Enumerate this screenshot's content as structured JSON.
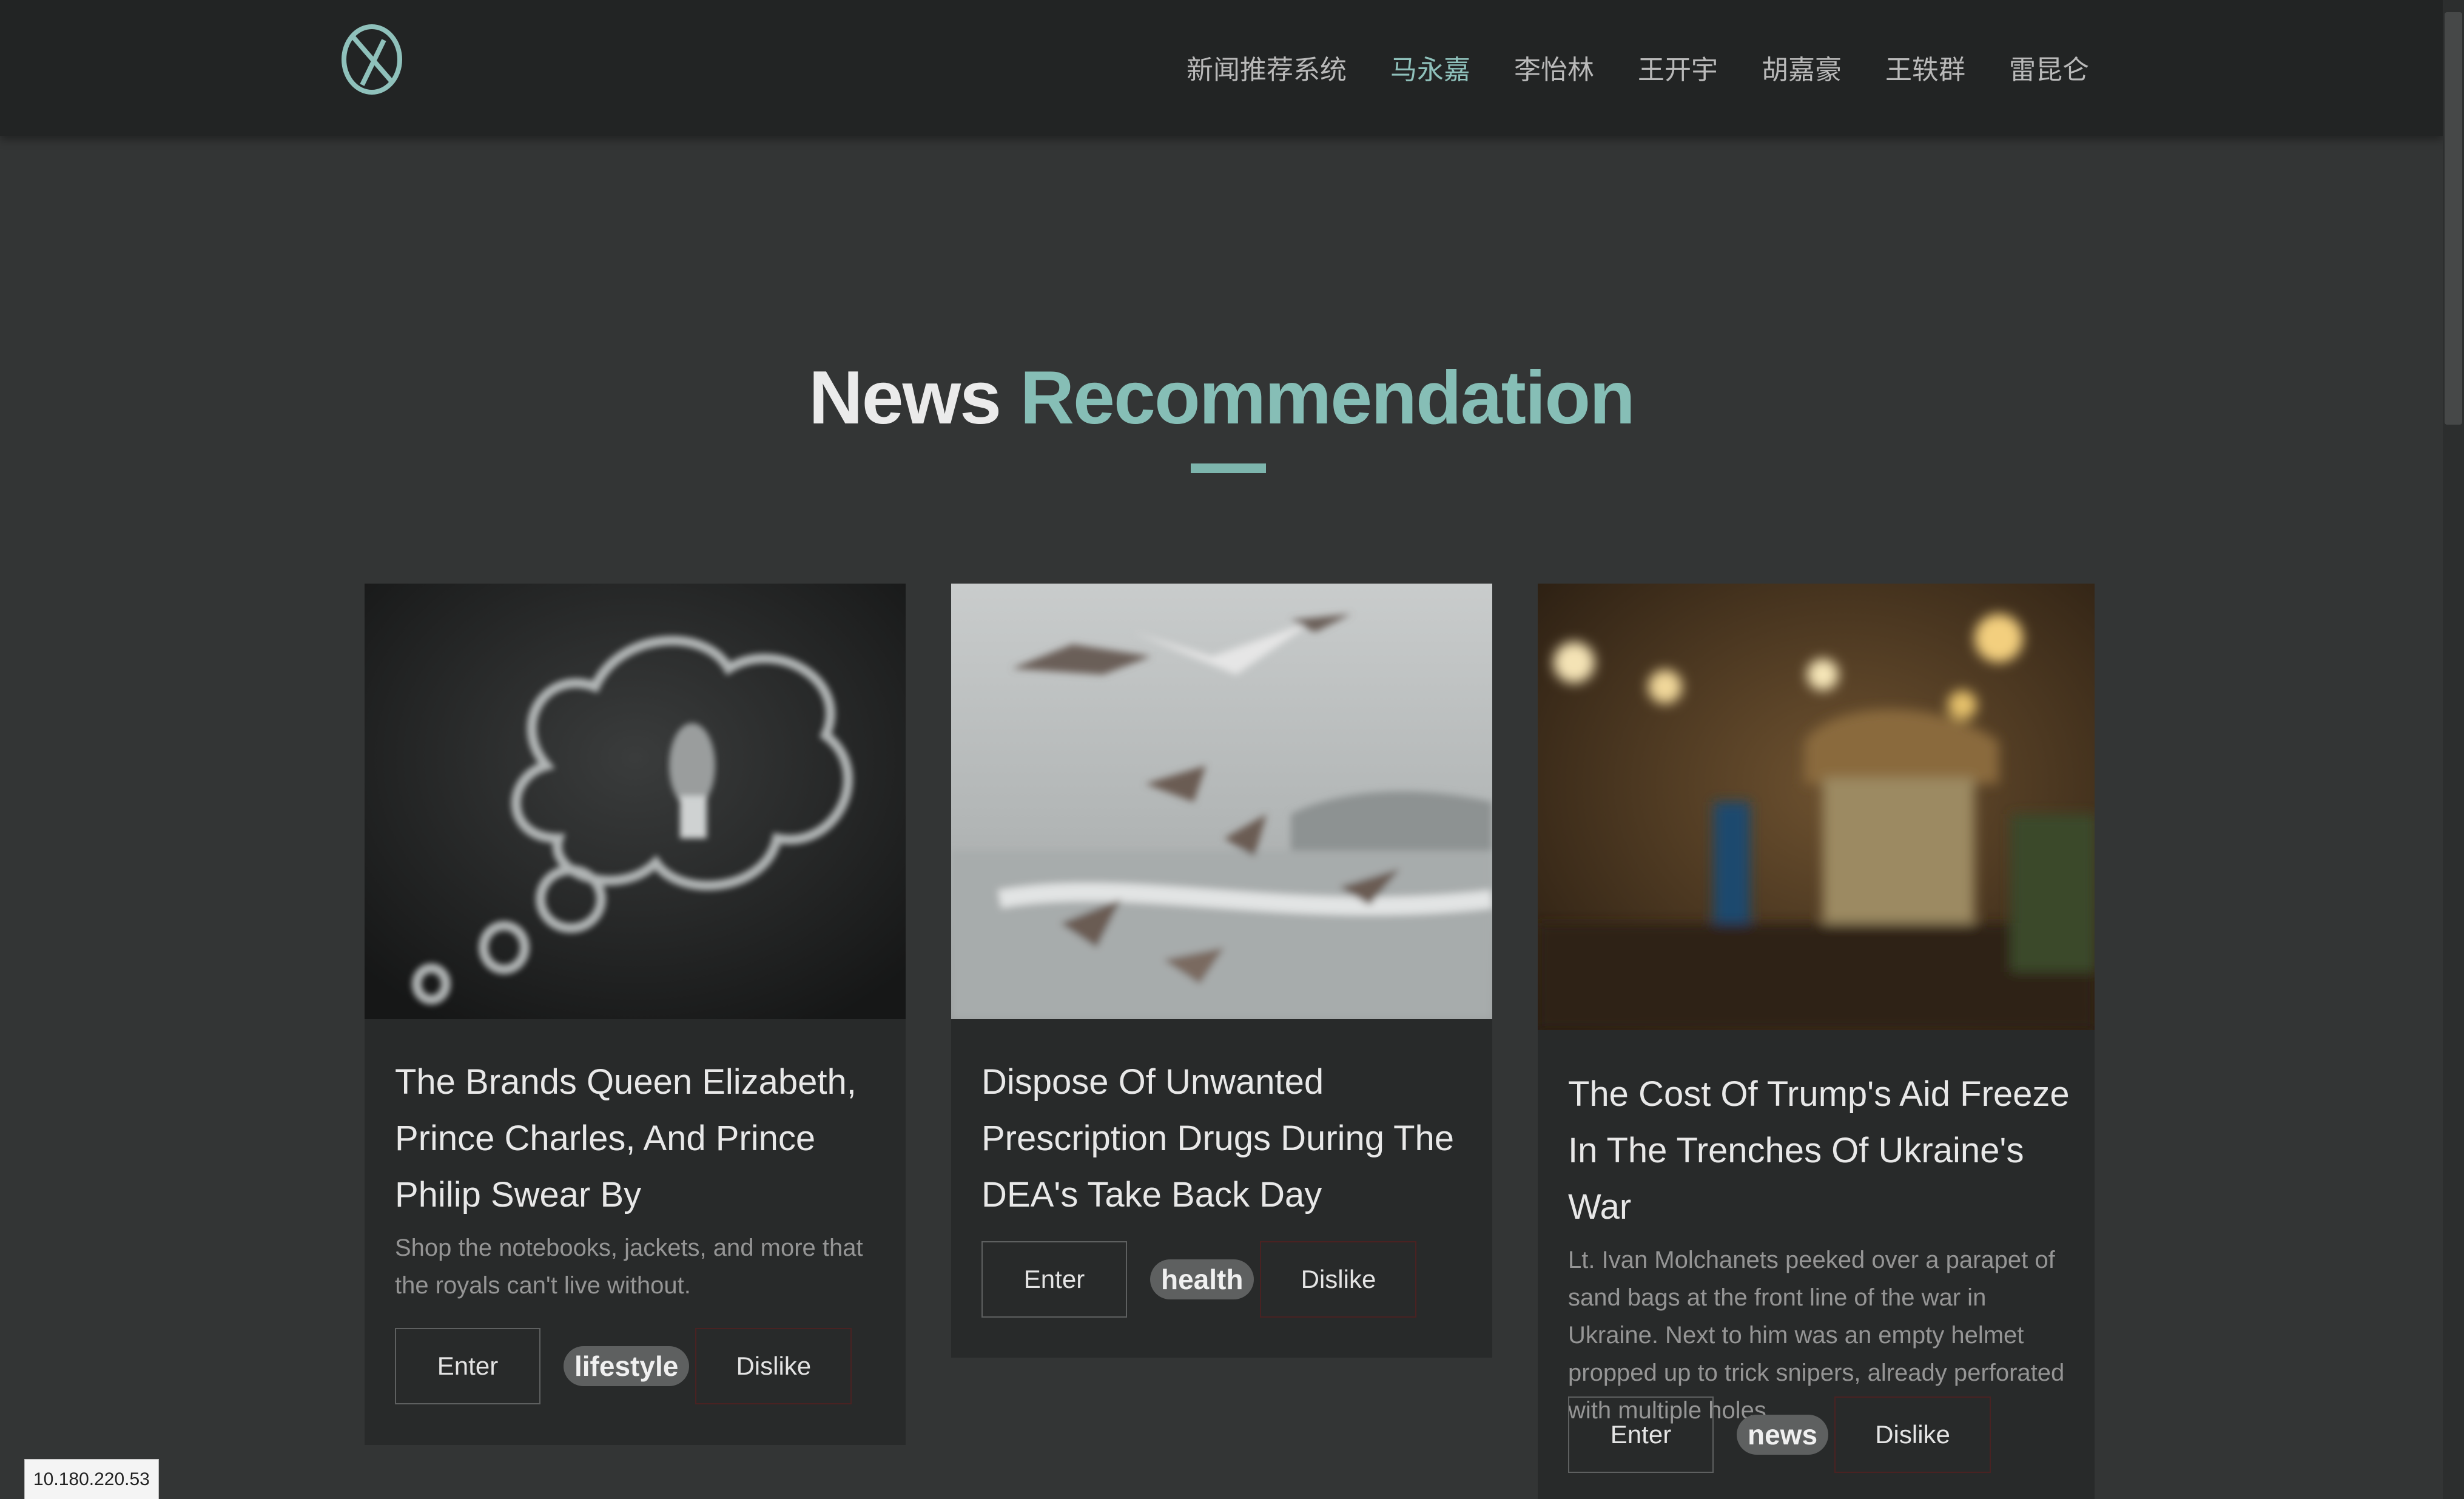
{
  "nav": {
    "links": [
      "新闻推荐系统",
      "马永嘉",
      "李怡林",
      "王开宇",
      "胡嘉豪",
      "王轶群",
      "雷昆仑"
    ],
    "active_index": 1
  },
  "heading": {
    "word1": "News",
    "word2": "Recommendation"
  },
  "cards": [
    {
      "title": "The Brands Queen Elizabeth, Prince Charles, And Prince Philip Swear By",
      "description": "Shop the notebooks, jackets, and more that the royals can't live without.",
      "enter_label": "Enter",
      "tag": "lifestyle",
      "dislike_label": "Dislike"
    },
    {
      "title": "Dispose Of Unwanted Prescription Drugs During The DEA's Take Back Day",
      "description": "",
      "enter_label": "Enter",
      "tag": "health",
      "dislike_label": "Dislike"
    },
    {
      "title": "The Cost Of Trump's Aid Freeze In The Trenches Of Ukraine's War",
      "description": "Lt. Ivan Molchanets peeked over a parapet of sand bags at the front line of the war in Ukraine. Next to him was an empty helmet propped up to trick snipers, already perforated with multiple holes.",
      "enter_label": "Enter",
      "tag": "news",
      "dislike_label": "Dislike"
    }
  ],
  "status": {
    "ip": "10.180.220.53"
  },
  "colors": {
    "accent": "#86beb6",
    "background": "#333535",
    "navbar": "#222424",
    "card": "#282a2a"
  }
}
